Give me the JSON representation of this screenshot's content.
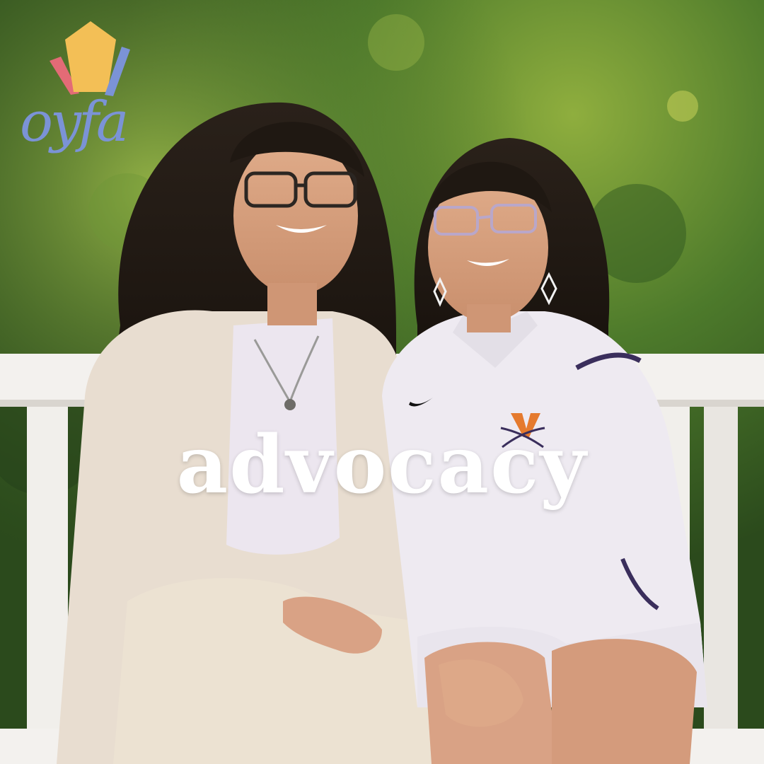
{
  "logo": {
    "wordmark": "oyfa",
    "colors": {
      "pentagon": "#f3bf56",
      "left_stroke": "#e36b76",
      "right_stroke": "#7b93d6",
      "wordmark": "#7b93d6"
    }
  },
  "headline": {
    "text": "advocacy",
    "color": "#ffffff"
  },
  "photo": {
    "icons": [
      "nike-swoosh-icon",
      "uva-v-sabres-icon",
      "pendant-necklace-icon",
      "diamond-earring-icon"
    ],
    "palette": {
      "foliage": "#3f6b2a",
      "bench": "#f3f1ee",
      "cardigan": "#e8ddd0",
      "polo": "#eeeaf1",
      "hair": "#1f1812",
      "skin": "#d7a07f"
    }
  }
}
